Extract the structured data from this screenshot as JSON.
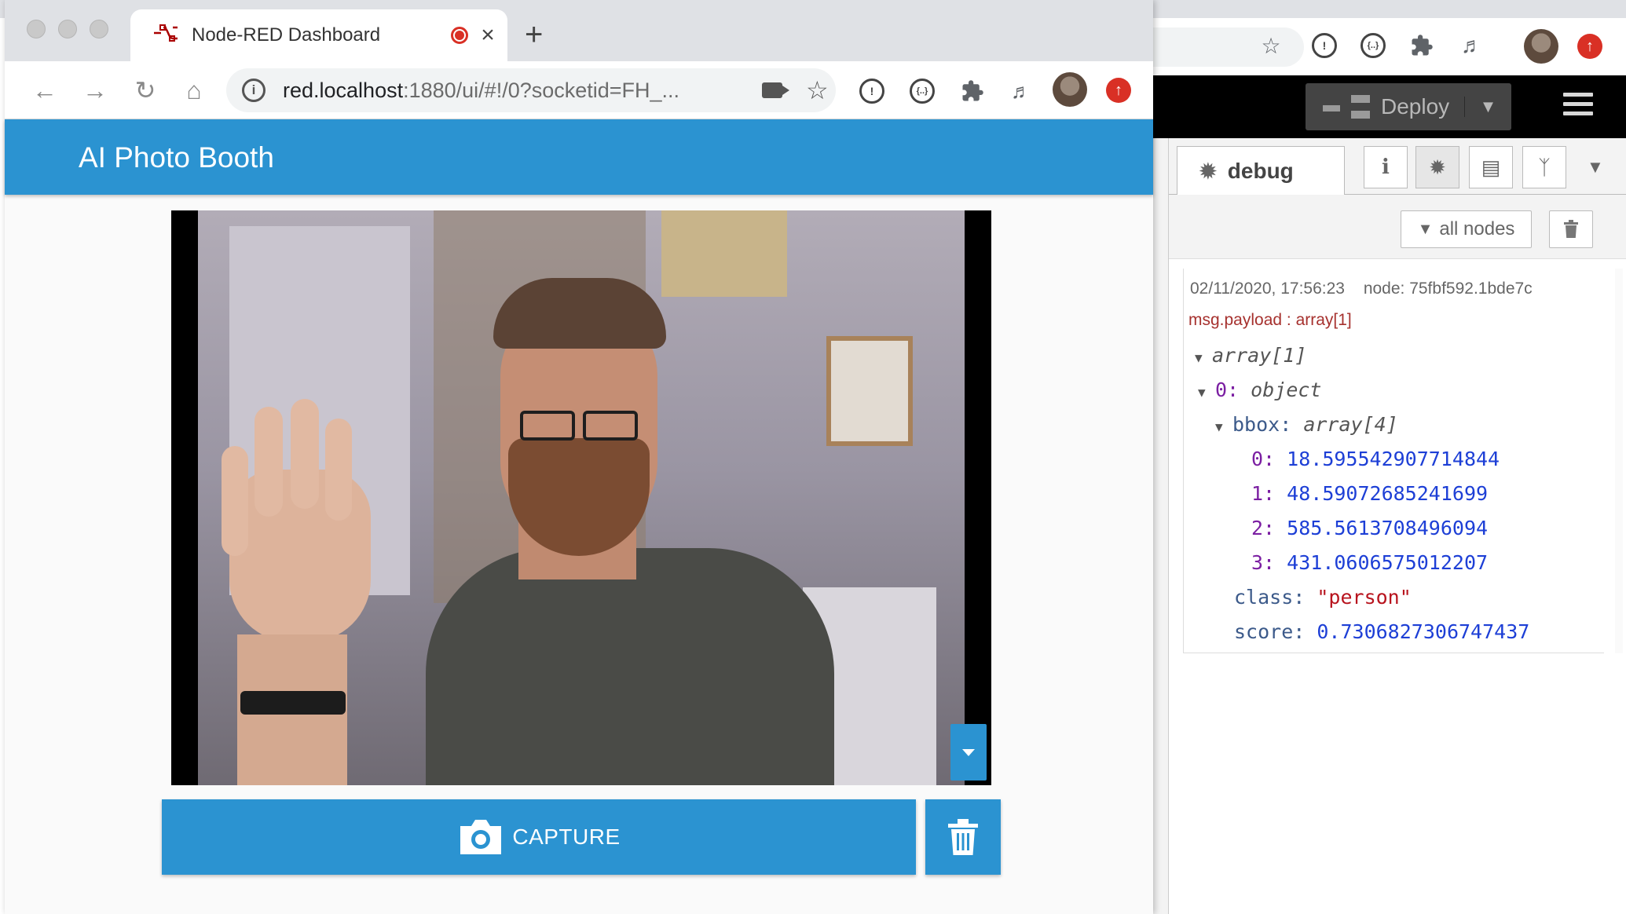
{
  "browser": {
    "tab_title": "Node-RED Dashboard",
    "new_tab_glyph": "+",
    "url_host": "red.localhost",
    "url_path": ":1880/ui/#!/0?socketid=FH_...",
    "tab_close_glyph": "×"
  },
  "dashboard": {
    "title": "AI Photo Booth",
    "capture_label": "CAPTURE"
  },
  "node_red": {
    "deploy_label": "Deploy",
    "sidebar_tab": "debug",
    "filter_label": "all nodes",
    "debug_message": {
      "timestamp": "02/11/2020, 17:56:23",
      "node": "node: 75fbf592.1bde7c",
      "topic": "msg.payload : array[1]",
      "root_type": "array[1]",
      "item_key": "0:",
      "item_type": "object",
      "bbox_key": "bbox:",
      "bbox_type": "array[4]",
      "bbox_values": [
        {
          "key": "0:",
          "value": "18.595542907714844"
        },
        {
          "key": "1:",
          "value": "48.59072685241699"
        },
        {
          "key": "2:",
          "value": "585.5613708496094"
        },
        {
          "key": "3:",
          "value": "431.0606575012207"
        }
      ],
      "class_key": "class:",
      "class_value": "\"person\"",
      "score_key": "score:",
      "score_value": "0.7306827306747437"
    }
  },
  "colors": {
    "dashboard_blue": "#2b93d1",
    "number_blue": "#1d3fd6",
    "string_red": "#b8141e",
    "topic_red": "#a6312e",
    "record_red": "#d93025"
  },
  "icons": [
    "back-icon",
    "forward-icon",
    "reload-icon",
    "home-icon",
    "site-info-icon",
    "camera-icon",
    "star-icon",
    "extensions-icon",
    "media-icon",
    "profile-avatar",
    "update-icon",
    "trash-icon",
    "filter-icon",
    "bug-icon",
    "info-icon",
    "book-icon",
    "branch-icon"
  ]
}
